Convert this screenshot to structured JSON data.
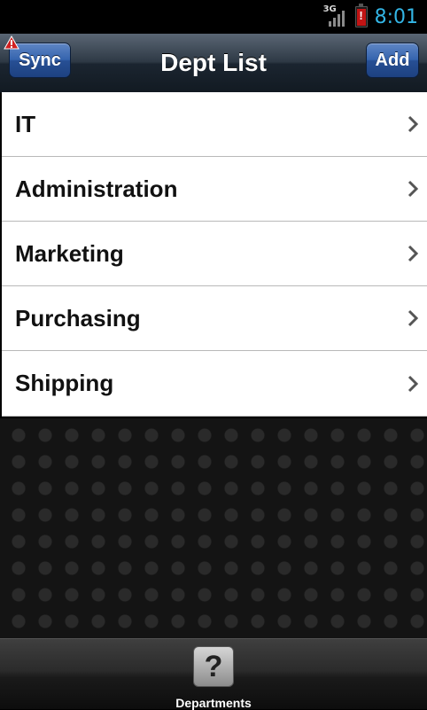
{
  "status": {
    "network": "3G",
    "time": "8:01"
  },
  "header": {
    "title": "Dept List",
    "sync_label": "Sync",
    "add_label": "Add"
  },
  "departments": [
    "IT",
    "Administration",
    "Marketing",
    "Purchasing",
    "Shipping"
  ],
  "tabs": [
    {
      "label": "Departments",
      "icon": "?"
    }
  ],
  "colors": {
    "clock": "#33b5e5",
    "button": "#3564ae",
    "warning": "#d12020",
    "battery": "#c11414"
  }
}
